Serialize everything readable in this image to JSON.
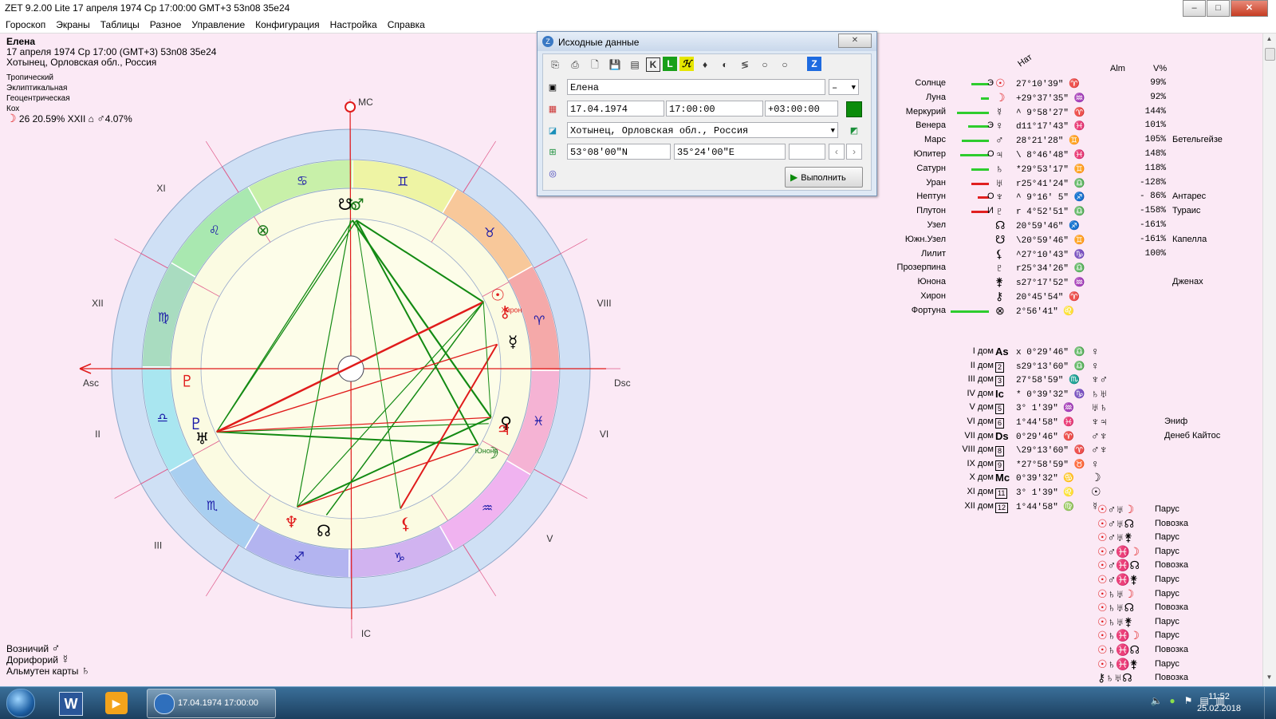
{
  "window": {
    "title": "ZET 9.2.00 Lite    17 апреля 1974   Ср   17:00:00 GMT+3  53n08  35e24",
    "min_label": "–",
    "max_label": "□",
    "close_label": "✕"
  },
  "menu": [
    "Гороскоп",
    "Экраны",
    "Таблицы",
    "Разное",
    "Управление",
    "Конфигурация",
    "Настройка",
    "Справка"
  ],
  "person": {
    "name": "Елена",
    "datetime_line": "17 апреля 1974  Ср  17:00 (GMT+3) 53n08  35e24",
    "place_line": "Хотынец, Орловская обл., Россия"
  },
  "system": [
    "Тропический",
    "Эклиптикальная",
    "Геоцентрическая",
    "Кох"
  ],
  "moon_line": {
    "symbol": "☽",
    "text": "26 20.59% XXII",
    "symbol2": "♂",
    "text2": "4.07%"
  },
  "bottom_info": [
    {
      "label": "Возничий",
      "symbol": "♂"
    },
    {
      "label": "Дорифорий",
      "symbol": "☿"
    },
    {
      "label": "Альмутен карты",
      "symbol": "♄"
    }
  ],
  "wheel": {
    "axes": {
      "mc": "MC",
      "ic": "IC",
      "asc": "Asc",
      "dsc": "Dsc"
    },
    "house_numerals": [
      "I",
      "II",
      "III",
      "IV",
      "V",
      "VI",
      "VII",
      "VIII",
      "IX",
      "X",
      "XI",
      "XII"
    ],
    "house_labels_shown": [
      "II",
      "III",
      "V",
      "VI",
      "VIII",
      "IX",
      "XI",
      "XII"
    ],
    "sign_glyphs": [
      "♈",
      "♉",
      "♊",
      "♋",
      "♌",
      "♍",
      "♎",
      "♏",
      "♐",
      "♑",
      "♒",
      "♓"
    ],
    "planet_labels": {
      "chiron": "Хирон",
      "juno": "Юнона",
      "retro": "R"
    }
  },
  "dialog": {
    "title": "Исходные данные",
    "close_label": "✕",
    "toolbar": [
      "⎘",
      "⎙",
      "🗋",
      "💾",
      "▤",
      "K",
      "L",
      "ℋ",
      "♦",
      "◐",
      "≶",
      "○",
      "○",
      "Z"
    ],
    "name_value": "Елена",
    "gender_value": "–",
    "date_value": "17.04.1974",
    "time_value": "17:00:00",
    "tz_value": "+03:00:00",
    "place_value": "Хотынец, Орловская обл., Россия",
    "lat_value": "53°08'00\"N",
    "lon_value": "35°24'00\"E",
    "extra_value": "",
    "run_label": "Выполнить",
    "nav_prev": "‹",
    "nav_next": "›"
  },
  "table_headers": {
    "nat": "Нат",
    "alm": "Alm",
    "v": "V%"
  },
  "planets": [
    {
      "name": "Солнце",
      "mark": "Э",
      "symbol": "☉",
      "pos": " 27°10'39\" ♈",
      "perc": "99%",
      "star": "",
      "bar": 22,
      "barColor": "green"
    },
    {
      "name": "Луна",
      "mark": "",
      "symbol": "☽",
      "pos": "+29°37'35\" ♒",
      "perc": "92%",
      "star": "",
      "bar": 10,
      "barColor": "green"
    },
    {
      "name": "Меркурий",
      "mark": "",
      "symbol": "☿",
      "pos": "^ 9°58'27\" ♈",
      "perc": "144%",
      "star": "",
      "bar": 40,
      "barColor": "green"
    },
    {
      "name": "Венера",
      "mark": "Э",
      "symbol": "♀",
      "pos": "d11°17'43\" ♓",
      "perc": "101%",
      "star": "",
      "bar": 26,
      "barColor": "green"
    },
    {
      "name": "Марс",
      "mark": "",
      "symbol": "♂",
      "pos": " 28°21'28\" ♊",
      "perc": "105%",
      "star": "Бетельгейзе",
      "bar": 34,
      "barColor": "green"
    },
    {
      "name": "Юпитер",
      "mark": "О",
      "symbol": "♃",
      "pos": "\\ 8°46'48\" ♓",
      "perc": "148%",
      "star": "",
      "bar": 36,
      "barColor": "green"
    },
    {
      "name": "Сатурн",
      "mark": "",
      "symbol": "♄",
      "pos": "*29°53'17\" ♊",
      "perc": "118%",
      "star": "",
      "bar": 22,
      "barColor": "green"
    },
    {
      "name": "Уран",
      "mark": "",
      "symbol": "♅",
      "pos": "r25°41'24\" ♎",
      "perc": "-128%",
      "star": "",
      "bar": 22,
      "barColor": "red"
    },
    {
      "name": "Нептун",
      "mark": "О",
      "symbol": "♆",
      "pos": "^ 9°16' 5\" ♐",
      "perc": "- 86%",
      "star": "Антарес",
      "bar": 14,
      "barColor": "red"
    },
    {
      "name": "Плутон",
      "mark": "И",
      "symbol": "♇",
      "pos": "r 4°52'51\" ♎",
      "perc": "-158%",
      "star": "Тураис",
      "bar": 22,
      "barColor": "red"
    },
    {
      "name": "Узел",
      "mark": "",
      "symbol": "☊",
      "pos": " 20°59'46\" ♐",
      "perc": "-161%",
      "star": "",
      "bar": 0,
      "barColor": "green"
    },
    {
      "name": "Южн.Узел",
      "mark": "",
      "symbol": "☋",
      "pos": "\\20°59'46\" ♊",
      "perc": "-161%",
      "star": "Капелла",
      "bar": 0,
      "barColor": "green"
    },
    {
      "name": "Лилит",
      "mark": "",
      "symbol": "⚸",
      "pos": "^27°10'43\" ♑",
      "perc": "100%",
      "star": "",
      "bar": 0,
      "barColor": "green"
    },
    {
      "name": "Прозерпина",
      "mark": "",
      "symbol": "♇",
      "pos": "r25°34'26\" ♎",
      "perc": "",
      "star": "",
      "bar": 0,
      "barColor": "green"
    },
    {
      "name": "Юнона",
      "mark": "",
      "symbol": "⚵",
      "pos": "s27°17'52\" ♒",
      "perc": "",
      "star": "Дженах",
      "bar": 0,
      "barColor": "green"
    },
    {
      "name": "Хирон",
      "mark": "",
      "symbol": "⚷",
      "pos": " 20°45'54\" ♈",
      "perc": "",
      "star": "",
      "bar": 0,
      "barColor": "green"
    },
    {
      "name": "Фортуна",
      "mark": "",
      "symbol": "⊗",
      "pos": " 2°56'41\" ♌",
      "perc": "",
      "star": "",
      "bar": 48,
      "barColor": "green"
    }
  ],
  "houses": [
    {
      "name": "I дом",
      "sym": "As",
      "pos": "x 0°29'46\" ♎",
      "rulers": "♀",
      "star": ""
    },
    {
      "name": "II дом",
      "sym": "2",
      "pos": "s29°13'60\" ♎",
      "rulers": "♀",
      "star": ""
    },
    {
      "name": "III дом",
      "sym": "3",
      "pos": " 27°58'59\" ♏",
      "rulers": "♆♂",
      "star": ""
    },
    {
      "name": "IV дом",
      "sym": "Ic",
      "pos": "* 0°39'32\" ♑",
      "rulers": "♄♅",
      "star": ""
    },
    {
      "name": "V дом",
      "sym": "5",
      "pos": " 3° 1'39\" ♒",
      "rulers": "♅♄",
      "star": ""
    },
    {
      "name": "VI дом",
      "sym": "6",
      "pos": " 1°44'58\" ♓",
      "rulers": "♆♃",
      "star": "Эниф"
    },
    {
      "name": "VII дом",
      "sym": "Ds",
      "pos": " 0°29'46\" ♈",
      "rulers": "♂♆",
      "star": "Денеб Кайтос"
    },
    {
      "name": "VIII дом",
      "sym": "8",
      "pos": "\\29°13'60\" ♈",
      "rulers": "♂♆",
      "star": ""
    },
    {
      "name": "IX дом",
      "sym": "9",
      "pos": "*27°58'59\" ♉",
      "rulers": "♀",
      "star": ""
    },
    {
      "name": "X дом",
      "sym": "Mc",
      "pos": " 0°39'32\" ♋",
      "rulers": "☽",
      "star": ""
    },
    {
      "name": "XI дом",
      "sym": "11",
      "pos": " 3° 1'39\" ♌",
      "rulers": "☉",
      "star": ""
    },
    {
      "name": "XII дом",
      "sym": "12",
      "pos": " 1°44'58\" ♍",
      "rulers": "☿",
      "star": ""
    }
  ],
  "figures": [
    {
      "sym": [
        "☉",
        "♂",
        "♅",
        "☽"
      ],
      "name": "Парус"
    },
    {
      "sym": [
        "☉",
        "♂",
        "♅",
        "☊"
      ],
      "name": "Повозка"
    },
    {
      "sym": [
        "☉",
        "♂",
        "♅",
        "⚵"
      ],
      "name": "Парус"
    },
    {
      "sym": [
        "☉",
        "♂",
        "♓",
        "☽"
      ],
      "name": "Парус"
    },
    {
      "sym": [
        "☉",
        "♂",
        "♓",
        "☊"
      ],
      "name": "Повозка"
    },
    {
      "sym": [
        "☉",
        "♂",
        "♓",
        "⚵"
      ],
      "name": "Парус"
    },
    {
      "sym": [
        "☉",
        "♄",
        "♅",
        "☽"
      ],
      "name": "Парус"
    },
    {
      "sym": [
        "☉",
        "♄",
        "♅",
        "☊"
      ],
      "name": "Повозка"
    },
    {
      "sym": [
        "☉",
        "♄",
        "♅",
        "⚵"
      ],
      "name": "Парус"
    },
    {
      "sym": [
        "☉",
        "♄",
        "♓",
        "☽"
      ],
      "name": "Парус"
    },
    {
      "sym": [
        "☉",
        "♄",
        "♓",
        "☊"
      ],
      "name": "Повозка"
    },
    {
      "sym": [
        "☉",
        "♄",
        "♓",
        "⚵"
      ],
      "name": "Парус"
    },
    {
      "sym": [
        "⚷",
        "♄",
        "♅",
        "☊"
      ],
      "name": "Повозка"
    }
  ],
  "taskbar": {
    "active_label": "17.04.1974  17:00:00",
    "time": "11:52",
    "date": "25.02.2018",
    "tray": [
      "🔈",
      "●",
      "⚑",
      "▤",
      "▥"
    ]
  }
}
